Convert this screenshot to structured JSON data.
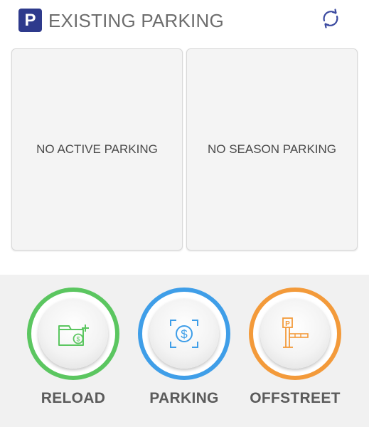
{
  "header": {
    "logo_letter": "P",
    "title": "EXISTING PARKING",
    "refresh_icon": "refresh-icon"
  },
  "cards": {
    "active": "NO ACTIVE PARKING",
    "season": "NO SEASON PARKING"
  },
  "actions": [
    {
      "label": "RELOAD",
      "icon": "wallet-add-icon",
      "color": "#5bc660"
    },
    {
      "label": "PARKING",
      "icon": "dollar-scan-icon",
      "color": "#3f9ee8"
    },
    {
      "label": "OFFSTREET",
      "icon": "parking-barrier-icon",
      "color": "#f39a3a"
    }
  ],
  "colors": {
    "brand": "#2e3a8c",
    "card_bg": "#f4f4f4",
    "bottom_bg": "#f1f1f1"
  }
}
